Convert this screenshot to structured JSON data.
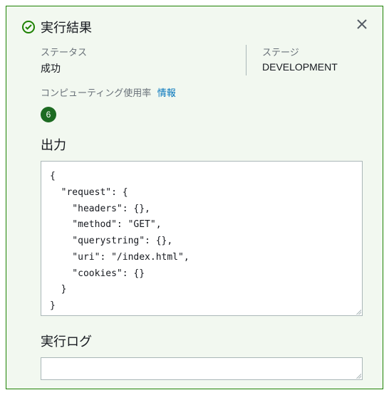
{
  "header": {
    "title": "実行結果"
  },
  "status": {
    "label": "ステータス",
    "value": "成功"
  },
  "stage": {
    "label": "ステージ",
    "value": "DEVELOPMENT"
  },
  "compute": {
    "label": "コンピューティング使用率",
    "info_text": "情報",
    "badge": "6"
  },
  "output": {
    "title": "出力",
    "content": "{\n  \"request\": {\n    \"headers\": {},\n    \"method\": \"GET\",\n    \"querystring\": {},\n    \"uri\": \"/index.html\",\n    \"cookies\": {}\n  }\n}"
  },
  "log": {
    "title": "実行ログ"
  }
}
